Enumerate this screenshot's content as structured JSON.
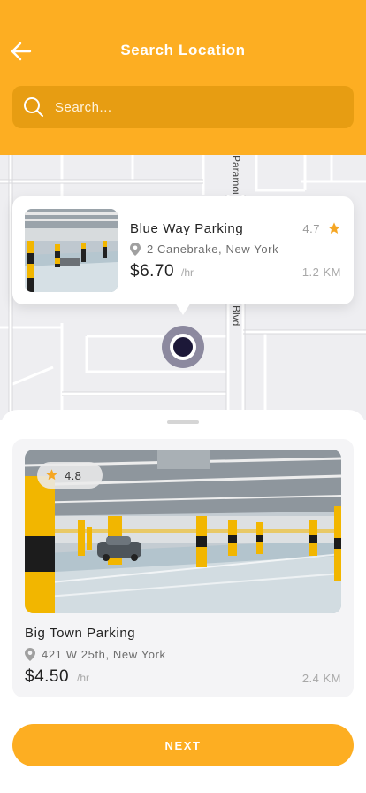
{
  "header": {
    "title": "Search Location",
    "search_placeholder": "Search..."
  },
  "map": {
    "street_label_1": "Paramount",
    "street_label_2": "Blvd"
  },
  "popup": {
    "name": "Blue Way Parking",
    "rating": "4.7",
    "address": "2 Canebrake, New York",
    "price": "$6.70",
    "per": "/hr",
    "distance": "1.2 KM"
  },
  "featured": {
    "rating": "4.8",
    "name": "Big Town Parking",
    "address": "421 W 25th, New York",
    "price": "$4.50",
    "per": "/hr",
    "distance": "2.4 KM"
  },
  "actions": {
    "next_label": "NEXT"
  },
  "colors": {
    "accent": "#FDAE22",
    "search_bg": "#E79D12",
    "star": "#F5A623",
    "marker": "#1C1838"
  },
  "icons": {
    "back": "arrow-left-icon",
    "search": "search-icon",
    "star": "star-icon",
    "pin": "map-pin-icon"
  }
}
